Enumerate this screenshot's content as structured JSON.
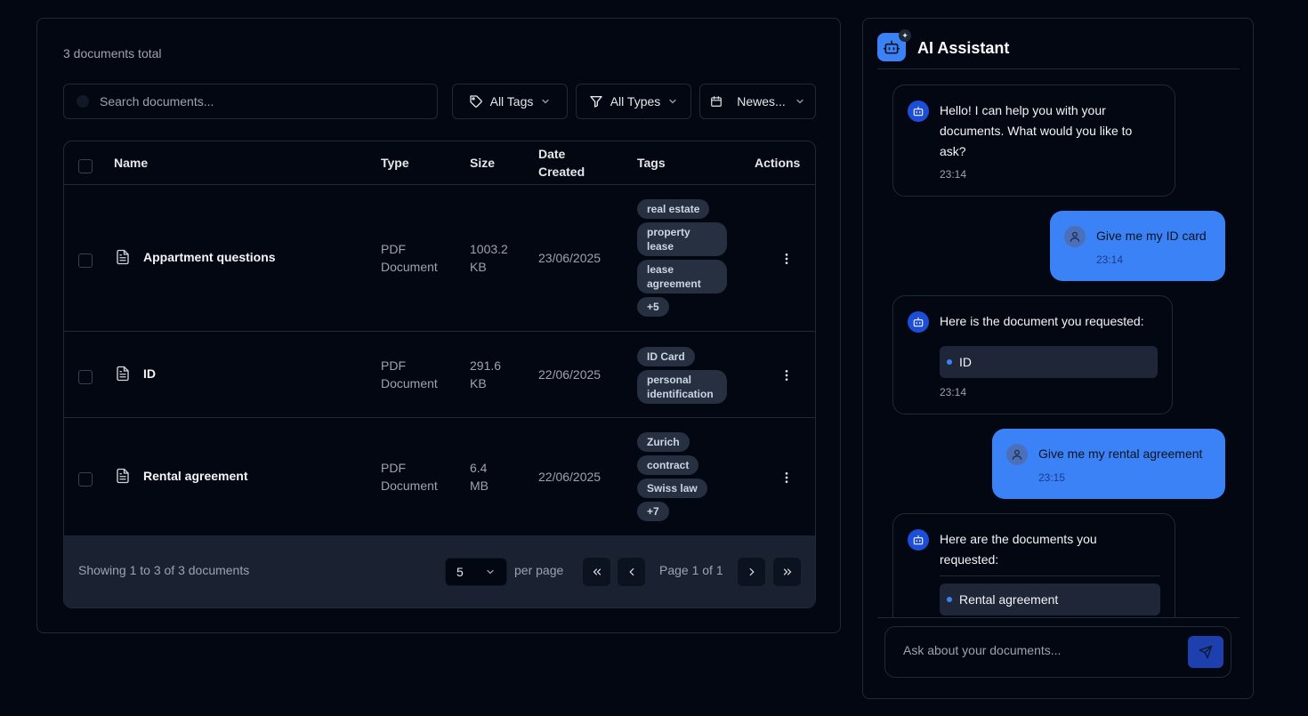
{
  "documents": {
    "count_text": "3 documents total",
    "search": {
      "placeholder": "Search documents..."
    },
    "filters": {
      "tags_label": "All Tags",
      "types_label": "All Types",
      "sort_label": "Newes..."
    },
    "table": {
      "headers": {
        "name": "Name",
        "type": "Type",
        "size": "Size",
        "date_line1": "Date",
        "date_line2": "Created",
        "tags": "Tags",
        "actions": "Actions"
      },
      "rows": [
        {
          "name": "Appartment questions",
          "type_line1": "PDF",
          "type_line2": "Document",
          "size_line1": "1003.2",
          "size_line2": "KB",
          "date": "23/06/2025",
          "tags": [
            "real estate",
            "property lease",
            "lease agreement",
            "+5"
          ]
        },
        {
          "name": "ID",
          "type_line1": "PDF",
          "type_line2": "Document",
          "size_line1": "291.6",
          "size_line2": "KB",
          "date": "22/06/2025",
          "tags": [
            "ID Card",
            "personal identification"
          ]
        },
        {
          "name": "Rental agreement",
          "type_line1": "PDF",
          "type_line2": "Document",
          "size_line1": "6.4",
          "size_line2": "MB",
          "date": "22/06/2025",
          "tags": [
            "Zurich",
            "contract",
            "Swiss law",
            "+7"
          ]
        }
      ]
    },
    "pagination": {
      "showing": "Showing 1 to 3 of 3 documents",
      "per_page_value": "5",
      "per_page_label": "per page",
      "page_label": "Page 1 of 1"
    }
  },
  "assistant": {
    "title": "AI Assistant",
    "messages": [
      {
        "role": "ai",
        "text_lines": [
          "Hello! I can help you with your",
          "documents. What would you like to",
          "ask?"
        ],
        "time": "23:14"
      },
      {
        "role": "user",
        "text": "Give me my ID card",
        "time": "23:14"
      },
      {
        "role": "ai",
        "text": "Here is the document you requested:",
        "doc": "ID",
        "time": "23:14"
      },
      {
        "role": "user",
        "text": "Give me my rental agreement",
        "time": "23:15"
      },
      {
        "role": "ai",
        "text_lines": [
          "Here are the documents you",
          "requested:"
        ],
        "doc": "Rental agreement"
      }
    ],
    "input": {
      "placeholder": "Ask about your documents..."
    }
  },
  "colors": {
    "background": "#030712",
    "accent": "#3b82f6",
    "border": "#1f2937",
    "tag_bg": "#263040"
  }
}
